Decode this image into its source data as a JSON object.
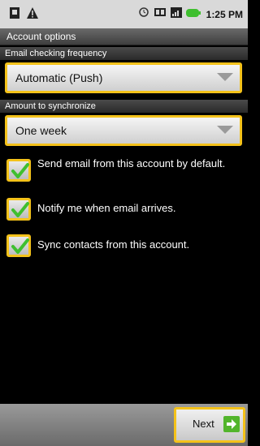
{
  "status_bar": {
    "time": "1:25 PM",
    "icons_left": [
      "sim-card-icon",
      "warning-icon"
    ],
    "icons_right": [
      "alarm-icon",
      "network-icon",
      "signal-icon",
      "battery-icon"
    ]
  },
  "title": "Account options",
  "frequency": {
    "label": "Email checking frequency",
    "value": "Automatic (Push)"
  },
  "sync": {
    "label": "Amount to synchronize",
    "value": "One week"
  },
  "options": [
    {
      "label": "Send email from this account by default.",
      "checked": true
    },
    {
      "label": "Notify me when email arrives.",
      "checked": true
    },
    {
      "label": "Sync contacts from this account.",
      "checked": true
    }
  ],
  "footer": {
    "next_label": "Next"
  },
  "colors": {
    "highlight": "#f4c21a",
    "check": "#3fbf2f",
    "next_icon": "#52b52b"
  }
}
